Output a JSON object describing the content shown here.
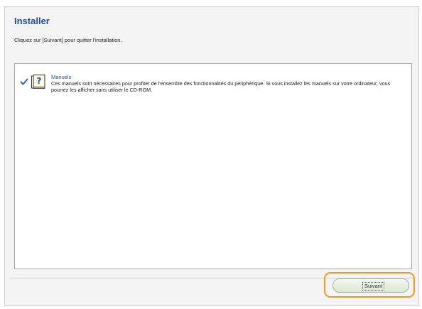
{
  "header": {
    "title": "Installer",
    "instruction": "Cliquez sur [Suivant] pour quitter l'installation."
  },
  "items": [
    {
      "title": "Manuels",
      "description": "Ces manuels sont nécessaires pour profiter de l'ensemble des fonctionnalités du périphérique. Si vous installez les manuels sur votre ordinateur, vous pourrez les afficher sans utiliser le CD-ROM.",
      "checked": true,
      "icon": "manual-help-icon"
    }
  ],
  "footer": {
    "next_label": "Suivant",
    "highlight_color": "#f39a1e"
  },
  "colors": {
    "title": "#1f4f96",
    "check": "#2a66c9"
  }
}
